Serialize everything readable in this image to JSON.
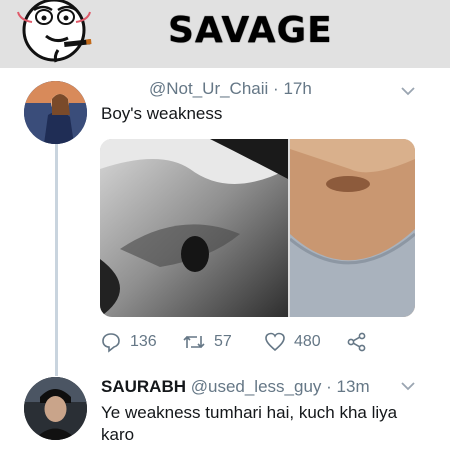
{
  "banner": {
    "title": "SAVAGE",
    "emoji_icon": "smoking-smirk-face-icon"
  },
  "tweet": {
    "handle": "@Not_Ur_Chaii",
    "separator": "·",
    "time": "17h",
    "text": "Boy's weakness",
    "menu_icon": "chevron-down-icon",
    "actions": {
      "reply_count": "136",
      "retweet_count": "57",
      "like_count": "480"
    }
  },
  "reply": {
    "name": "SAURABH",
    "handle": "@used_less_guy",
    "separator": "·",
    "time": "13m",
    "text": "Ye weakness tumhari hai, kuch kha liya karo",
    "menu_icon": "chevron-down-icon"
  },
  "colors": {
    "banner_bg": "#e1e1e1",
    "muted": "#657786",
    "thread_line": "#c9d4de",
    "text": "#14171a"
  }
}
